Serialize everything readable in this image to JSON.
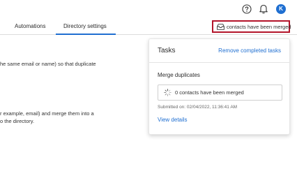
{
  "header": {
    "help_icon": "question-circle-icon",
    "notifications_icon": "bell-icon",
    "avatar_initial": "K",
    "accent_color": "#1f6fd1"
  },
  "tabs": [
    {
      "label": "Automations",
      "active": false
    },
    {
      "label": "Directory settings",
      "active": true
    }
  ],
  "merge_status_button": {
    "icon": "inbox-tray-icon",
    "label": "contacts have been merged",
    "highlight_color": "#b3142a"
  },
  "background_text": {
    "line1": "he same email or name) so that duplicate",
    "line2": "r example, email) and merge them into a",
    "line3": "o the directory."
  },
  "tasks_panel": {
    "title": "Tasks",
    "remove_link": "Remove completed tasks",
    "task": {
      "name": "Merge duplicates",
      "status_icon": "spinner-icon",
      "status": "0 contacts have been merged",
      "submitted": "Submitted on: 02/04/2022, 11:36:41 AM",
      "details_link": "View details"
    }
  }
}
